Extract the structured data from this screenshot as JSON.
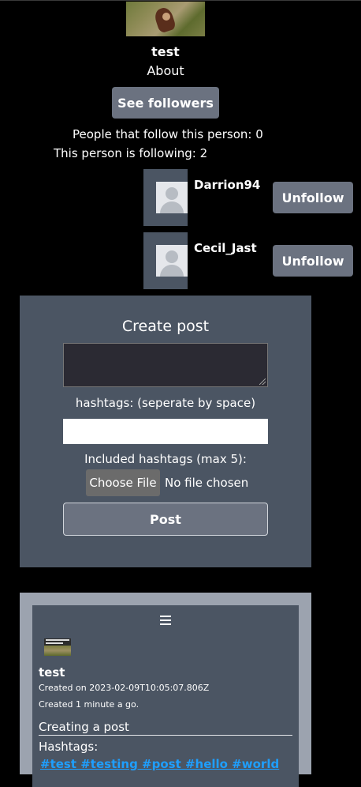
{
  "profile": {
    "username": "test",
    "about_label": "About",
    "see_followers_label": "See followers",
    "followers_text": "People that follow this person: 0",
    "following_text": "This person is following: 2"
  },
  "following": [
    {
      "name": "Darrion94",
      "unfollow_label": "Unfollow"
    },
    {
      "name": "Cecil_Jast",
      "unfollow_label": "Unfollow"
    }
  ],
  "create_post": {
    "title": "Create post",
    "hashtags_label": "hashtags: (seperate by space)",
    "included_label": "Included hashtags (max 5):",
    "choose_file_label": "Choose File",
    "no_file_text": "No file chosen",
    "post_label": "Post"
  },
  "feed": {
    "username": "test",
    "created_on": "Created on 2023-02-09T10:05:07.806Z",
    "created_ago": "Created 1 minute a go.",
    "text": "Creating a post",
    "hashtags_title": "Hashtags:",
    "tags": "#test #testing #post #hello #world"
  },
  "colors": {
    "background": "#000000",
    "panel": "#4b5563",
    "button": "#6b7280",
    "feed_border": "#9ca3af",
    "link": "#1e9fff"
  }
}
